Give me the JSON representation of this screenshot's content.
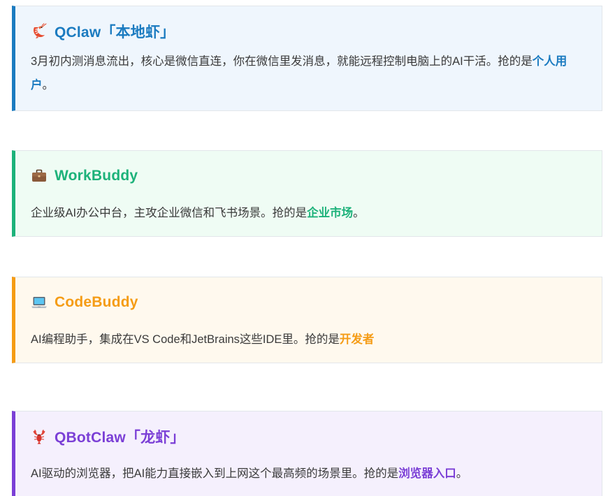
{
  "cards": [
    {
      "icon": "shrimp-icon",
      "title": "QClaw「本地虾」",
      "body": "3月初内测消息流出，核心是微信直连，你在微信里发消息，就能远程控制电脑上的AI干活。抢的是",
      "highlight": "个人用户",
      "tail": "。",
      "accent": "#1b7bc0",
      "bg": "#eff6fd"
    },
    {
      "icon": "briefcase-icon",
      "title": "WorkBuddy",
      "body": "企业级AI办公中台，主攻企业微信和飞书场景。抢的是",
      "highlight": "企业市场",
      "tail": "。",
      "accent": "#1db27a",
      "bg": "#effcf4"
    },
    {
      "icon": "laptop-icon",
      "title": "CodeBuddy",
      "body": "AI编程助手，集成在VS Code和JetBrains这些IDE里。抢的是",
      "highlight": "开发者",
      "tail": "",
      "accent": "#f59c15",
      "bg": "#fff9ee"
    },
    {
      "icon": "lobster-icon",
      "title": "QBotClaw「龙虾」",
      "body": "AI驱动的浏览器，把AI能力直接嵌入到上网这个最高频的场景里。抢的是",
      "highlight": "浏览器入口",
      "tail": "。",
      "accent": "#7b3fd6",
      "bg": "#f5f0fd"
    }
  ]
}
